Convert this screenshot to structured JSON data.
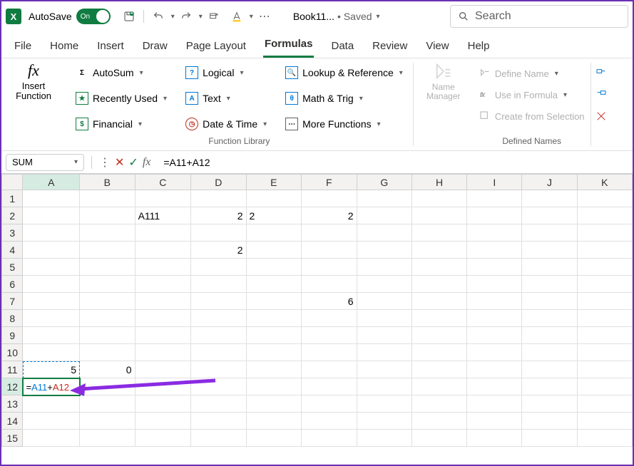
{
  "titlebar": {
    "autosave_label": "AutoSave",
    "autosave_state": "On",
    "doc_name": "Book11...",
    "saved_label": "Saved",
    "search_placeholder": "Search"
  },
  "tabs": [
    "File",
    "Home",
    "Insert",
    "Draw",
    "Page Layout",
    "Formulas",
    "Data",
    "Review",
    "View",
    "Help"
  ],
  "active_tab": "Formulas",
  "ribbon": {
    "insert_function": "Insert Function",
    "function_library_label": "Function Library",
    "defined_names_label": "Defined Names",
    "fn_items": {
      "autosum": "AutoSum",
      "recently_used": "Recently Used",
      "financial": "Financial",
      "logical": "Logical",
      "text": "Text",
      "date_time": "Date & Time",
      "lookup": "Lookup & Reference",
      "math_trig": "Math & Trig",
      "more_functions": "More Functions"
    },
    "name_manager": "Name Manager",
    "define_name": "Define Name",
    "use_in_formula": "Use in Formula",
    "create_from_selection": "Create from Selection"
  },
  "formula_bar": {
    "name_box": "SUM",
    "formula": "=A11+A12"
  },
  "grid": {
    "columns": [
      "A",
      "B",
      "C",
      "D",
      "E",
      "F",
      "G",
      "H",
      "I",
      "J",
      "K"
    ],
    "rows": 15,
    "selected_col": "A",
    "selected_row": 12,
    "editing": {
      "cell": "A12",
      "parts": [
        {
          "text": "=",
          "class": ""
        },
        {
          "text": "A11",
          "class": "fref-blue"
        },
        {
          "text": "+",
          "class": ""
        },
        {
          "text": "A12",
          "class": "fref-red"
        }
      ]
    },
    "cells": {
      "C2": "A111",
      "D2": "2",
      "E2": "2",
      "F2": "2",
      "D4": "2",
      "F7": "6",
      "A11": "5",
      "B11": "0"
    }
  }
}
